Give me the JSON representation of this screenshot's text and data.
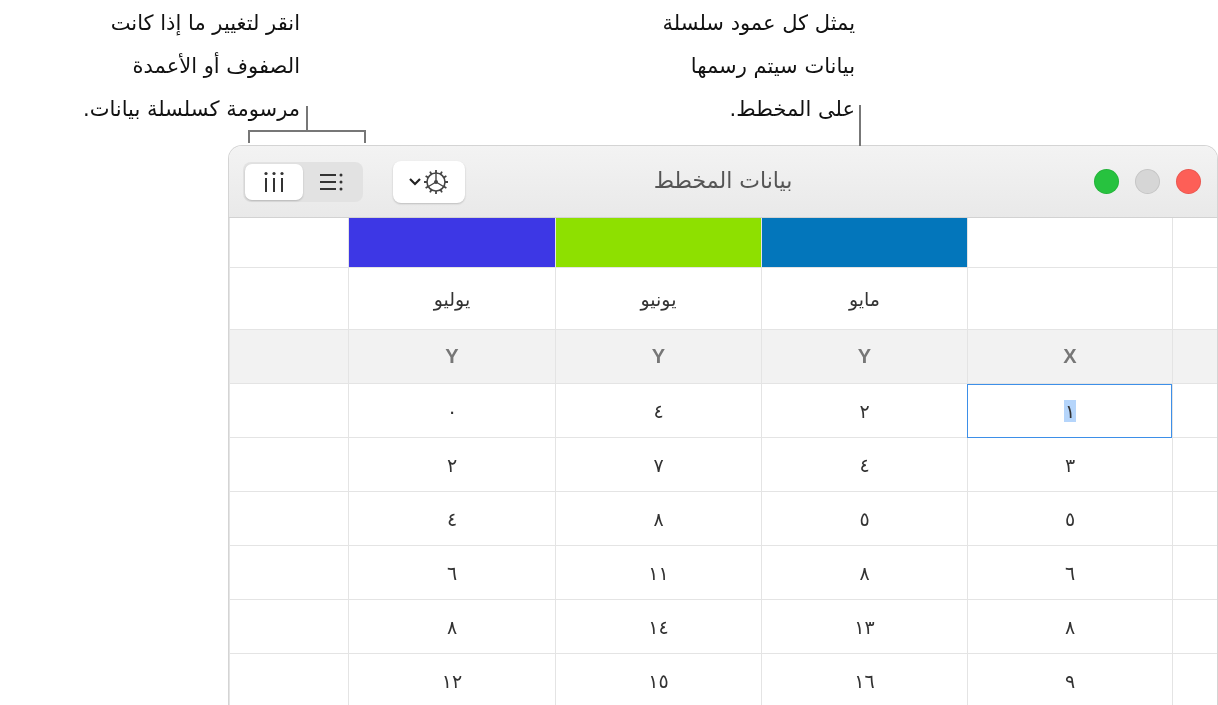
{
  "callouts": [
    {
      "lines": [
        "يمثل كل عمود سلسلة",
        "بيانات سيتم رسمها",
        "على المخطط."
      ]
    },
    {
      "lines": [
        "انقر لتغيير ما إذا كانت",
        "الصفوف أو الأعمدة",
        "مرسومة كسلسلة بيانات."
      ]
    }
  ],
  "window": {
    "title": "بيانات المخطط"
  },
  "toolbar": {
    "segments": [
      {
        "kind": "columns",
        "selected": true
      },
      {
        "kind": "rows",
        "selected": false
      }
    ]
  },
  "series": [
    {
      "name": "مايو",
      "color": "#0376bb"
    },
    {
      "name": "يونيو",
      "color": "#8ee000"
    },
    {
      "name": "يوليو",
      "color": "#3d37e5"
    }
  ],
  "header": [
    "X",
    "Y",
    "Y",
    "Y"
  ],
  "rows": [
    [
      {
        "text": "١",
        "selected": true
      },
      {
        "text": "٢",
        "selected": false
      },
      {
        "text": "٤",
        "selected": false
      },
      {
        "text": "٠",
        "selected": false
      }
    ],
    [
      {
        "text": "٣",
        "selected": false
      },
      {
        "text": "٤",
        "selected": false
      },
      {
        "text": "٧",
        "selected": false
      },
      {
        "text": "٢",
        "selected": false
      }
    ],
    [
      {
        "text": "٥",
        "selected": false
      },
      {
        "text": "٥",
        "selected": false
      },
      {
        "text": "٨",
        "selected": false
      },
      {
        "text": "٤",
        "selected": false
      }
    ],
    [
      {
        "text": "٦",
        "selected": false
      },
      {
        "text": "٨",
        "selected": false
      },
      {
        "text": "١١",
        "selected": false
      },
      {
        "text": "٦",
        "selected": false
      }
    ],
    [
      {
        "text": "٨",
        "selected": false
      },
      {
        "text": "١٣",
        "selected": false
      },
      {
        "text": "١٤",
        "selected": false
      },
      {
        "text": "٨",
        "selected": false
      }
    ],
    [
      {
        "text": "٩",
        "selected": false
      },
      {
        "text": "١٦",
        "selected": false
      },
      {
        "text": "١٥",
        "selected": false
      },
      {
        "text": "١٢",
        "selected": false
      }
    ]
  ]
}
